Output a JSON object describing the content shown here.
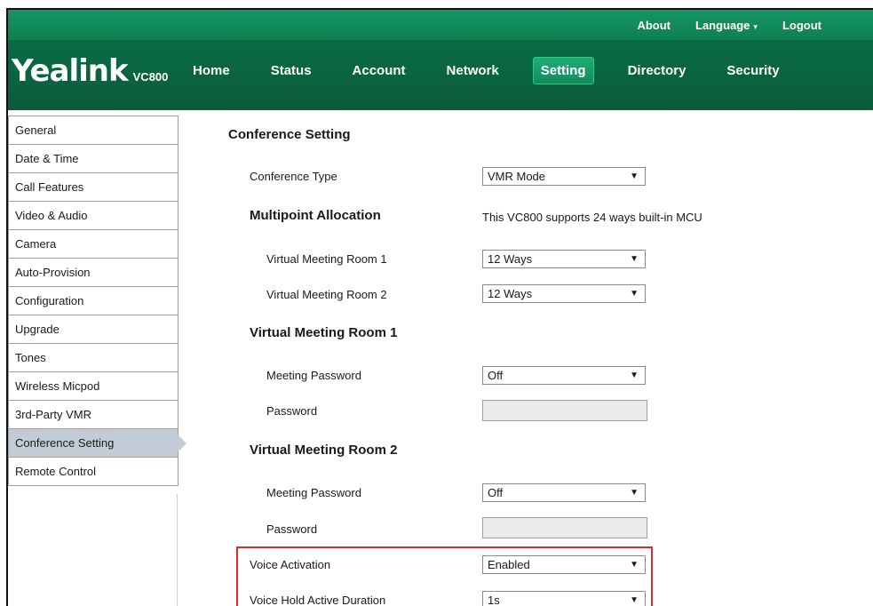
{
  "topbar": {
    "about": "About",
    "language": "Language",
    "language_caret": "▾",
    "logout": "Logout"
  },
  "brand": {
    "name": "Yealink",
    "model": "VC800"
  },
  "nav": {
    "tabs": [
      "Home",
      "Status",
      "Account",
      "Network",
      "Setting",
      "Directory",
      "Security"
    ],
    "active": "Setting"
  },
  "sidebar": {
    "items": [
      "General",
      "Date & Time",
      "Call Features",
      "Video & Audio",
      "Camera",
      "Auto-Provision",
      "Configuration",
      "Upgrade",
      "Tones",
      "Wireless Micpod",
      "3rd-Party VMR",
      "Conference Setting",
      "Remote Control"
    ],
    "active": "Conference Setting"
  },
  "main": {
    "title": "Conference Setting",
    "conference_type": {
      "label": "Conference Type",
      "value": "VMR Mode"
    },
    "multipoint": {
      "title": "Multipoint Allocation",
      "note": "This VC800 supports 24 ways built-in MCU",
      "vmr1": {
        "label": "Virtual Meeting Room 1",
        "value": "12 Ways"
      },
      "vmr2": {
        "label": "Virtual Meeting Room 2",
        "value": "12 Ways"
      }
    },
    "vmr1_section": {
      "title": "Virtual Meeting Room 1",
      "meeting_password": {
        "label": "Meeting Password",
        "value": "Off"
      },
      "password": {
        "label": "Password",
        "value": ""
      }
    },
    "vmr2_section": {
      "title": "Virtual Meeting Room 2",
      "meeting_password": {
        "label": "Meeting Password",
        "value": "Off"
      },
      "password": {
        "label": "Password",
        "value": ""
      }
    },
    "voice_activation": {
      "label": "Voice Activation",
      "value": "Enabled"
    },
    "voice_hold": {
      "label": "Voice Hold Active Duration",
      "value": "1s"
    },
    "dropdown_arrow": "▼"
  },
  "colors": {
    "topbar_green": "#169664",
    "nav_green": "#0b5b3b",
    "active_tab": "#1fae75",
    "sidebar_active": "#c3cbd6",
    "highlight_red": "#e0282c"
  },
  "icons": {
    "dropdown": "chevron-down-icon",
    "language_caret": "caret-down-icon"
  }
}
